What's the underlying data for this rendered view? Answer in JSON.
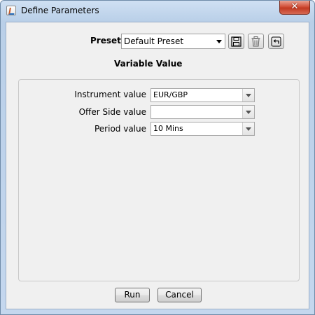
{
  "window": {
    "title": "Define Parameters",
    "close_symbol": "✕"
  },
  "preset": {
    "label": "Preset",
    "value": "Default Preset",
    "buttons": {
      "save": "save-icon",
      "delete": "trash-icon",
      "revert": "undo-icon"
    }
  },
  "variables": {
    "heading": "Variable Value",
    "rows": [
      {
        "label": "Instrument value",
        "value": "EUR/GBP"
      },
      {
        "label": "Offer Side value",
        "value": ""
      },
      {
        "label": "Period value",
        "value": "10 Mins"
      }
    ]
  },
  "actions": {
    "run_label": "Run",
    "cancel_label": "Cancel"
  }
}
